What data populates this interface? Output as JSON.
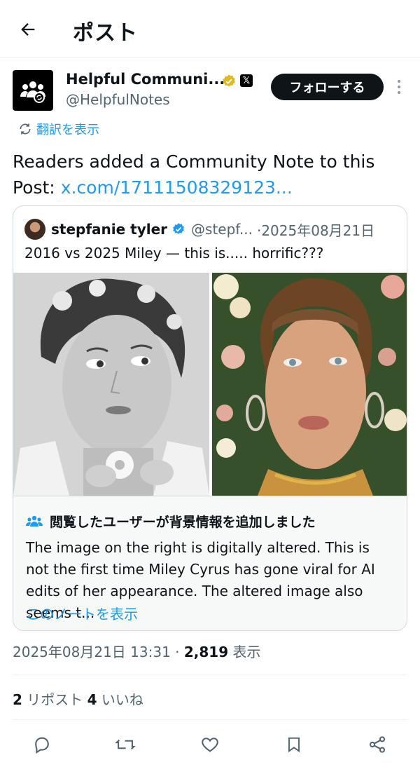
{
  "header": {
    "title": "ポスト",
    "back_icon": "arrow-left-icon"
  },
  "author": {
    "display_name": "Helpful Communi...",
    "handle": "@HelpfulNotes",
    "verified_color": "#e2b719",
    "follow_label": "フォローする"
  },
  "translate_label": "翻訳を表示",
  "post": {
    "text": "Readers added a Community Note to this Post: ",
    "link": "x.com/17111508329123..."
  },
  "quote": {
    "name": "stepfanie tyler",
    "handle": "@stepf...",
    "date": "·2025年08月21日",
    "text": "2016 vs 2025 Miley — this is..... horrific???"
  },
  "note": {
    "title": "閲覧したユーザーが背景情報を追加しました",
    "body": "The image on the right is digitally altered. This is not the first time Miley Cyrus has gone viral for AI edits of her appearance. The altered image also seems t...",
    "link": "このノートを表示"
  },
  "meta": {
    "datetime": "2025年08月21日 13:31 · ",
    "views_count": "2,819",
    "views_label": " 表示"
  },
  "stats": {
    "reposts_count": "2",
    "reposts_label": " リポスト ",
    "likes_count": "4",
    "likes_label": " いいね"
  },
  "colors": {
    "link": "#1d9bf0",
    "secondary": "#536471",
    "verified_blue": "#1d9bf0"
  }
}
